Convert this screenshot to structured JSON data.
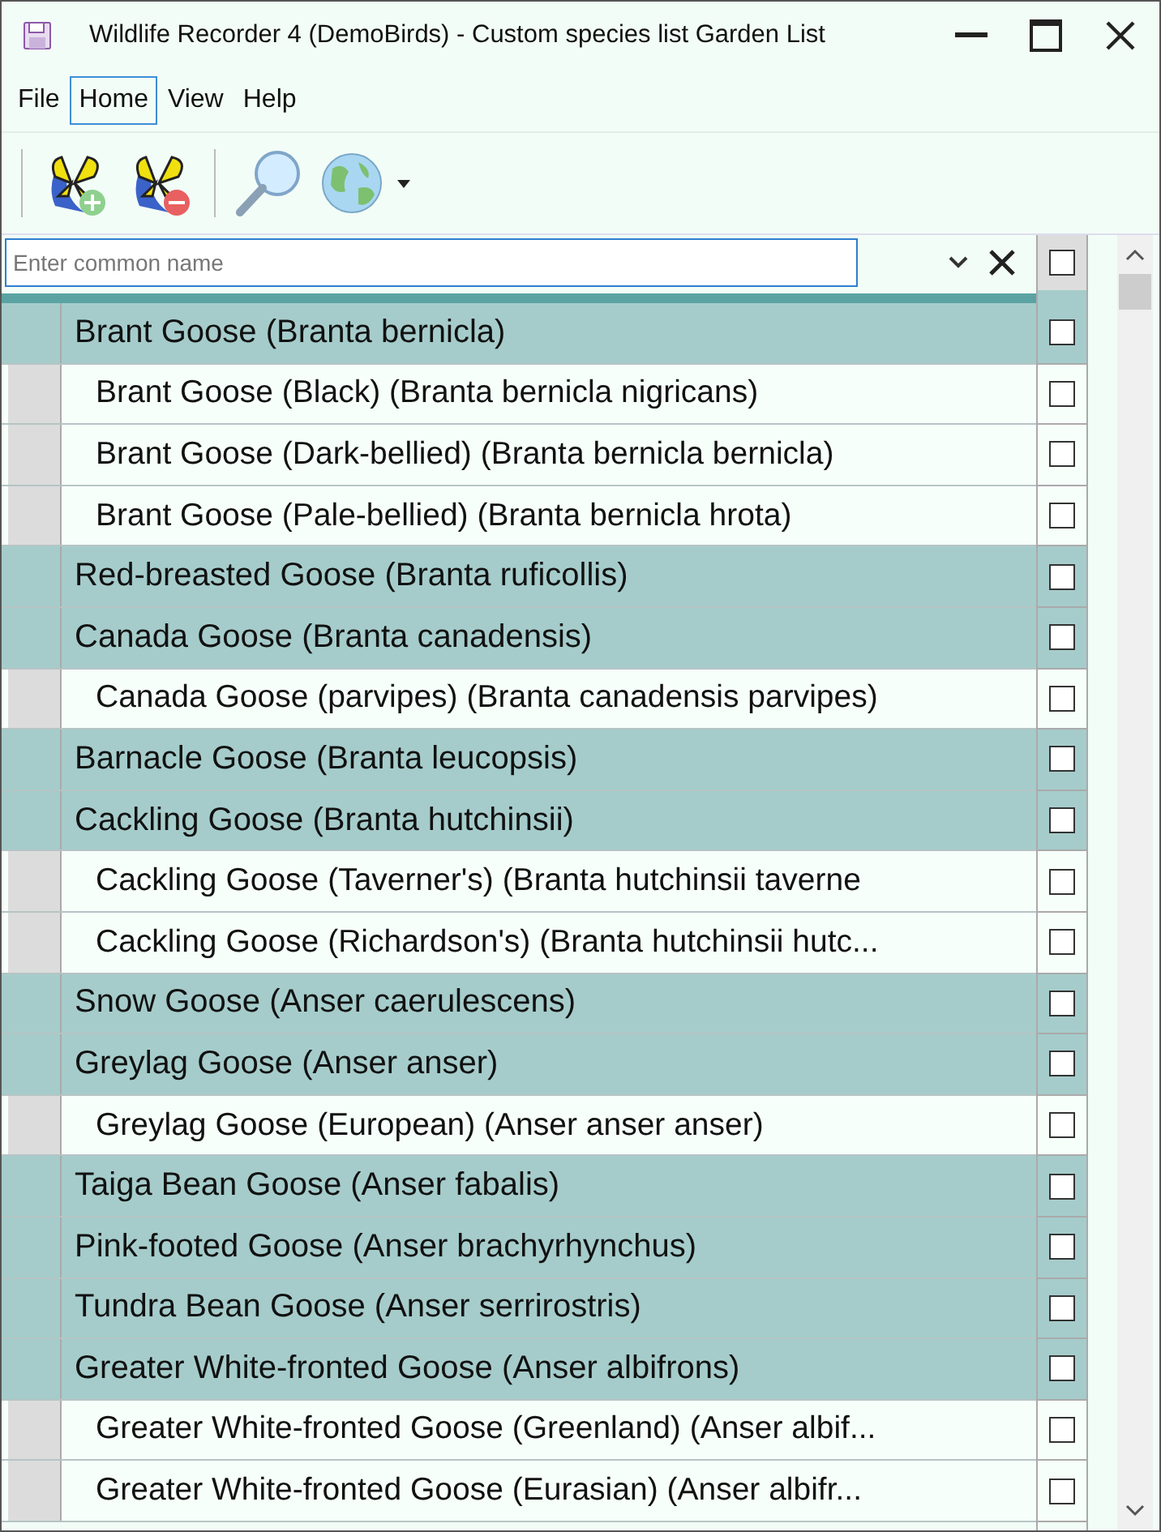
{
  "window": {
    "title": "Wildlife Recorder 4 (DemoBirds) - Custom species list Garden List"
  },
  "menu": [
    {
      "label": "File",
      "selected": false
    },
    {
      "label": "Home",
      "selected": true
    },
    {
      "label": "View",
      "selected": false
    },
    {
      "label": "Help",
      "selected": false
    }
  ],
  "search": {
    "placeholder": "Enter common name"
  },
  "header_checkbox": {
    "checked": false
  },
  "rows": [
    {
      "kind": "species",
      "name": "Brant Goose (Branta bernicla)",
      "checked": false
    },
    {
      "kind": "subspecies",
      "name": "Brant Goose (Black) (Branta bernicla nigricans)",
      "checked": false
    },
    {
      "kind": "subspecies",
      "name": "Brant Goose (Dark-bellied) (Branta bernicla bernicla)",
      "checked": false
    },
    {
      "kind": "subspecies",
      "name": "Brant Goose (Pale-bellied) (Branta bernicla hrota)",
      "checked": false
    },
    {
      "kind": "species",
      "name": "Red-breasted Goose (Branta ruficollis)",
      "checked": false
    },
    {
      "kind": "species",
      "name": "Canada Goose (Branta canadensis)",
      "checked": false
    },
    {
      "kind": "subspecies",
      "name": "Canada Goose (parvipes) (Branta canadensis parvipes)",
      "checked": false
    },
    {
      "kind": "species",
      "name": "Barnacle Goose (Branta leucopsis)",
      "checked": false
    },
    {
      "kind": "species",
      "name": "Cackling Goose (Branta hutchinsii)",
      "checked": false
    },
    {
      "kind": "subspecies",
      "name": "Cackling Goose (Taverner's) (Branta hutchinsii taverne",
      "checked": false
    },
    {
      "kind": "subspecies",
      "name": "Cackling Goose (Richardson's) (Branta hutchinsii hutc...",
      "checked": false
    },
    {
      "kind": "species",
      "name": "Snow Goose (Anser caerulescens)",
      "checked": false
    },
    {
      "kind": "species",
      "name": "Greylag Goose (Anser anser)",
      "checked": false
    },
    {
      "kind": "subspecies",
      "name": "Greylag Goose (European) (Anser anser anser)",
      "checked": false
    },
    {
      "kind": "species",
      "name": "Taiga Bean Goose (Anser fabalis)",
      "checked": false
    },
    {
      "kind": "species",
      "name": "Pink-footed Goose (Anser brachyrhynchus)",
      "checked": false
    },
    {
      "kind": "species",
      "name": "Tundra Bean Goose (Anser serrirostris)",
      "checked": false
    },
    {
      "kind": "species",
      "name": "Greater White-fronted Goose (Anser albifrons)",
      "checked": false
    },
    {
      "kind": "subspecies",
      "name": "Greater White-fronted Goose (Greenland) (Anser albif...",
      "checked": false
    },
    {
      "kind": "subspecies",
      "name": "Greater White-fronted Goose (Eurasian) (Anser albifr...",
      "checked": false
    }
  ]
}
